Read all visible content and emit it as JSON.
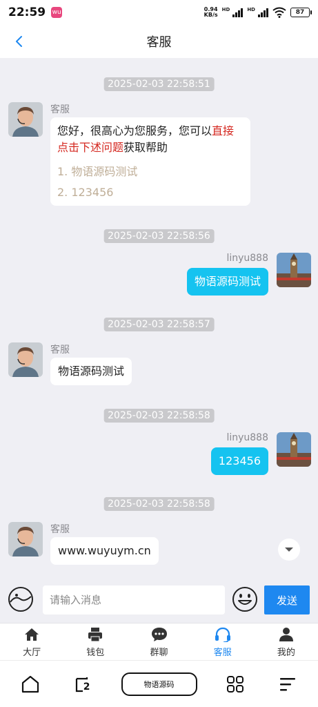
{
  "status_bar": {
    "time": "22:59",
    "app_badge": "wu",
    "net_speed_value": "0.94",
    "net_speed_unit": "KB/s",
    "hd_label_1": "HD",
    "hd_label_2": "HD",
    "battery": "87"
  },
  "header": {
    "title": "客服"
  },
  "chat": {
    "messages": [
      {
        "time": "2025-02-03 22:58:51",
        "sender": "客服",
        "intro_part1": "您好，很高心为您服务，您可以",
        "intro_red_1": "直",
        "intro_red_2": "接点击下述问题",
        "intro_part2": "获取帮助",
        "faq": [
          "1. 物语源码测试",
          "2. 123456"
        ]
      },
      {
        "time": "2025-02-03 22:58:56",
        "sender": "linyu888",
        "text": "物语源码测试"
      },
      {
        "time": "2025-02-03 22:58:57",
        "sender": "客服",
        "text": "物语源码测试"
      },
      {
        "time": "2025-02-03 22:58:58",
        "sender": "linyu888",
        "text": "123456"
      },
      {
        "time": "2025-02-03 22:58:58",
        "sender": "客服",
        "text": "www.wuyuym.cn"
      }
    ]
  },
  "input_bar": {
    "placeholder": "请输入消息",
    "send_label": "发送"
  },
  "tab_bar": {
    "items": [
      {
        "label": "大厅",
        "icon": "home-icon"
      },
      {
        "label": "钱包",
        "icon": "printer-icon"
      },
      {
        "label": "群聊",
        "icon": "chat-icon"
      },
      {
        "label": "客服",
        "icon": "headset-icon"
      },
      {
        "label": "我的",
        "icon": "user-icon"
      }
    ],
    "active_color": "#1e88f0"
  },
  "sys_nav": {
    "pill_label": "物语源码",
    "recents_count": "2"
  }
}
